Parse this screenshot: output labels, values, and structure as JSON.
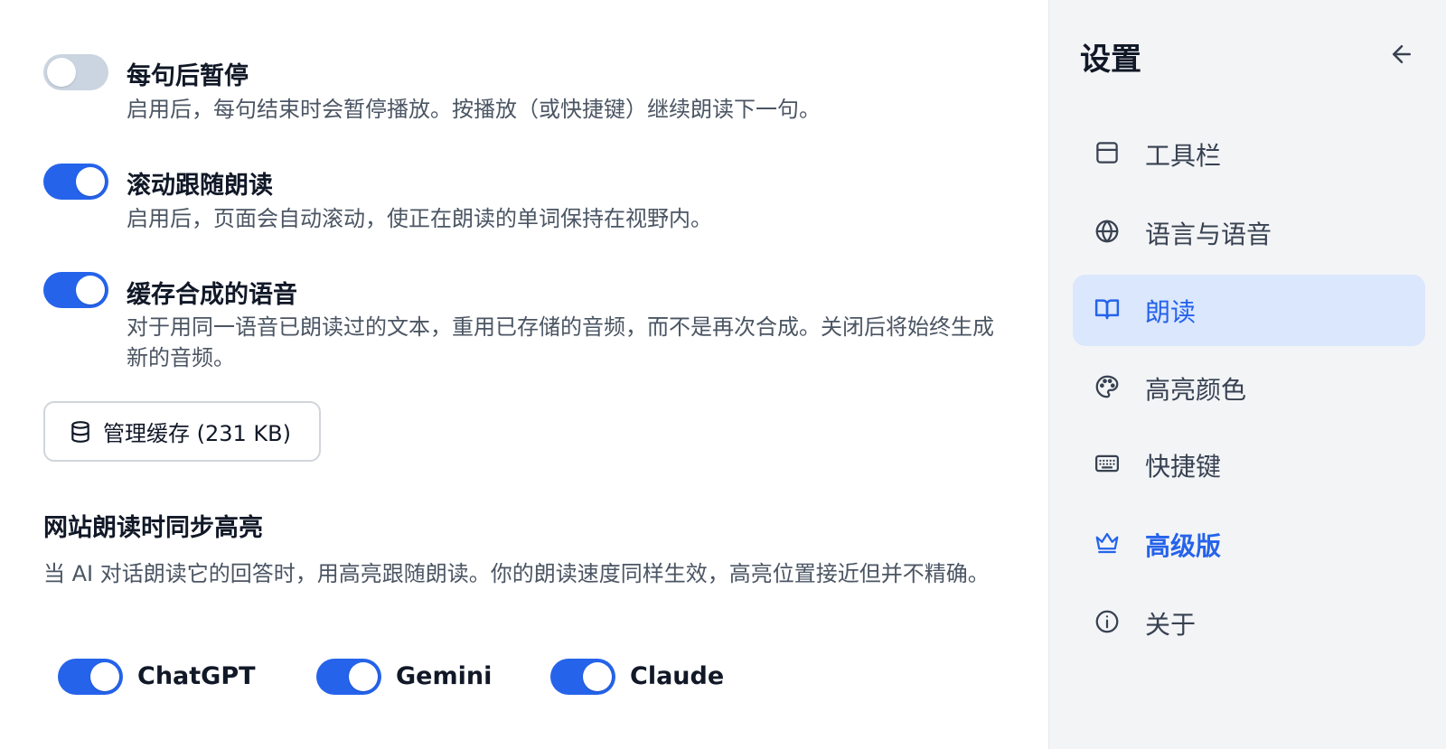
{
  "options": [
    {
      "title": "每句后暂停",
      "description": "启用后，每句结束时会暂停播放。按播放（或快捷键）继续朗读下一句。",
      "enabled": false
    },
    {
      "title": "滚动跟随朗读",
      "description": "启用后，页面会自动滚动，使正在朗读的单词保持在视野内。",
      "enabled": true
    },
    {
      "title": "缓存合成的语音",
      "description": "对于用同一语音已朗读过的文本，重用已存储的音频，而不是再次合成。关闭后将始终生成新的音频。",
      "enabled": true
    }
  ],
  "cache_button": {
    "label": "管理缓存 (231 KB)",
    "icon": "database-icon"
  },
  "site_sync": {
    "title": "网站朗读时同步高亮",
    "description": "当 AI 对话朗读它的回答时，用高亮跟随朗读。你的朗读速度同样生效，高亮位置接近但并不精确。",
    "sites": [
      {
        "label": "ChatGPT",
        "enabled": true
      },
      {
        "label": "Gemini",
        "enabled": true
      },
      {
        "label": "Claude",
        "enabled": true
      }
    ]
  },
  "sidebar": {
    "title": "设置",
    "back_icon": "arrow-left-icon",
    "items": [
      {
        "label": "工具栏",
        "icon": "toolbar-icon",
        "active": false
      },
      {
        "label": "语言与语音",
        "icon": "globe-icon",
        "active": false
      },
      {
        "label": "朗读",
        "icon": "book-icon",
        "active": true
      },
      {
        "label": "高亮颜色",
        "icon": "palette-icon",
        "active": false
      },
      {
        "label": "快捷键",
        "icon": "keyboard-icon",
        "active": false
      },
      {
        "label": "高级版",
        "icon": "crown-icon",
        "active": false
      },
      {
        "label": "关于",
        "icon": "info-icon",
        "active": false
      }
    ]
  },
  "colors": {
    "accent": "#2563eb",
    "toggle_off": "#cbd5e1",
    "active_bg": "#dbe7fd",
    "sidebar_bg": "#f3f4f6"
  }
}
